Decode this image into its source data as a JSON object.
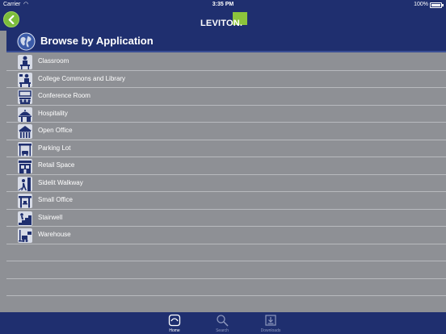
{
  "status_bar": {
    "carrier": "Carrier",
    "time": "3:35 PM",
    "battery": "100%"
  },
  "nav": {
    "logo": "LEVITON."
  },
  "section": {
    "title": "Browse by Application"
  },
  "items": [
    {
      "label": "Classroom",
      "icon": "classroom-icon"
    },
    {
      "label": "College Commons and Library",
      "icon": "college-commons-icon"
    },
    {
      "label": "Conference Room",
      "icon": "conference-room-icon"
    },
    {
      "label": "Hospitality",
      "icon": "hospitality-icon"
    },
    {
      "label": "Open Office",
      "icon": "open-office-icon"
    },
    {
      "label": "Parking Lot",
      "icon": "parking-lot-icon"
    },
    {
      "label": "Retail Space",
      "icon": "retail-space-icon"
    },
    {
      "label": "Sidelit Walkway",
      "icon": "sidelit-walkway-icon"
    },
    {
      "label": "Small Office",
      "icon": "small-office-icon"
    },
    {
      "label": "Stairwell",
      "icon": "stairwell-icon"
    },
    {
      "label": "Warehouse",
      "icon": "warehouse-icon"
    }
  ],
  "tabs": [
    {
      "label": "Home",
      "icon": "home-icon",
      "active": true
    },
    {
      "label": "Search",
      "icon": "search-icon",
      "active": false
    },
    {
      "label": "Downloads",
      "icon": "downloads-icon",
      "active": false
    }
  ],
  "colors": {
    "navy": "#1f2f6f",
    "green": "#7cbd3b",
    "list_background": "#8e9095"
  }
}
